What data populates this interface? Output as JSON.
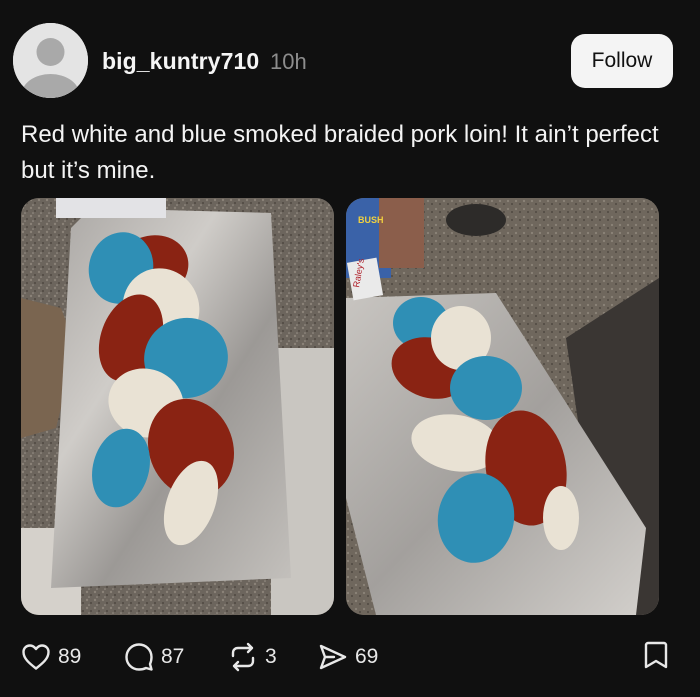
{
  "post": {
    "username": "big_kuntry710",
    "time": "10h",
    "follow_label": "Follow",
    "text": "Red white and blue smoked braided  pork loin! It ain’t perfect but it’s mine.",
    "images": [
      {
        "alt_icon": "photo-braided-loin-top-view"
      },
      {
        "alt_icon": "photo-braided-loin-angle-view"
      }
    ],
    "image_labels": {
      "bag_brand": "BUSH",
      "store_bag": "Raley's"
    }
  },
  "actions": {
    "likes": "89",
    "comments": "87",
    "reposts": "3",
    "shares": "69"
  },
  "icons": {
    "like": "heart-icon",
    "comment": "comment-bubble-icon",
    "repost": "repost-icon",
    "share": "send-icon",
    "bookmark": "bookmark-icon"
  },
  "colors": {
    "background": "#101010",
    "meat_red": "#8a2313",
    "meat_blue": "#2f8fb5",
    "meat_white": "#e9e2d4",
    "foil": "#b7b4b1"
  }
}
